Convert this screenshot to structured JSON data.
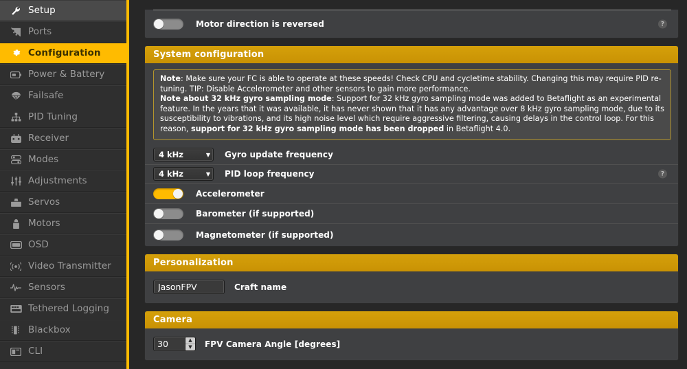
{
  "app": {
    "accent": "#ffbb00",
    "header_color": "#cd9706",
    "panel_bg": "#3f4042",
    "sidebar_bg": "#2f2f2f"
  },
  "sidebar": {
    "items": [
      {
        "label": "Setup",
        "icon": "wrench-icon",
        "state": "hover"
      },
      {
        "label": "Ports",
        "icon": "plug-icon",
        "state": "normal"
      },
      {
        "label": "Configuration",
        "icon": "gear-icon",
        "state": "selected"
      },
      {
        "label": "Power & Battery",
        "icon": "battery-icon",
        "state": "normal"
      },
      {
        "label": "Failsafe",
        "icon": "parachute-icon",
        "state": "normal"
      },
      {
        "label": "PID Tuning",
        "icon": "sitemap-icon",
        "state": "normal"
      },
      {
        "label": "Receiver",
        "icon": "transmitter-icon",
        "state": "normal"
      },
      {
        "label": "Modes",
        "icon": "sliders-stack-icon",
        "state": "normal"
      },
      {
        "label": "Adjustments",
        "icon": "faders-icon",
        "state": "normal"
      },
      {
        "label": "Servos",
        "icon": "servo-icon",
        "state": "normal"
      },
      {
        "label": "Motors",
        "icon": "motor-icon",
        "state": "normal"
      },
      {
        "label": "OSD",
        "icon": "osd-icon",
        "state": "normal"
      },
      {
        "label": "Video Transmitter",
        "icon": "antenna-icon",
        "state": "normal"
      },
      {
        "label": "Sensors",
        "icon": "waveform-icon",
        "state": "normal"
      },
      {
        "label": "Tethered Logging",
        "icon": "logging-icon",
        "state": "normal"
      },
      {
        "label": "Blackbox",
        "icon": "blackbox-icon",
        "state": "normal"
      },
      {
        "label": "CLI",
        "icon": "terminal-icon",
        "state": "normal"
      }
    ]
  },
  "main": {
    "motor_panel": {
      "motor_direction": {
        "label": "Motor direction is reversed",
        "toggle_on": false,
        "help": "?"
      }
    },
    "system_configuration": {
      "title": "System configuration",
      "note": {
        "note1_bold": "Note",
        "note1_text": ": Make sure your FC is able to operate at these speeds! Check CPU and cycletime stability. Changing this may require PID re-tuning. TIP: Disable Accelerometer and other sensors to gain more performance.",
        "note2_bold": "Note about 32 kHz gyro sampling mode",
        "note2_text_a": ": Support for 32 kHz gyro sampling mode was added to Betaflight as an experimental feature. In the years that it was available, it has never shown that it has any advantage over 8 kHz gyro sampling mode, due to its susceptibility to vibrations, and its high noise level which require aggressive filtering, causing delays in the control loop. For this reason, ",
        "note2_bold_tail": "support for 32 kHz gyro sampling mode has been dropped",
        "note2_text_b": " in Betaflight 4.0."
      },
      "gyro_update": {
        "value": "4 kHz",
        "label": "Gyro update frequency"
      },
      "pid_loop": {
        "value": "4 kHz",
        "label": "PID loop frequency",
        "help": "?"
      },
      "accelerometer": {
        "label": "Accelerometer",
        "toggle_on": true
      },
      "barometer": {
        "label": "Barometer (if supported)",
        "toggle_on": false
      },
      "magnetometer": {
        "label": "Magnetometer (if supported)",
        "toggle_on": false
      }
    },
    "personalization": {
      "title": "Personalization",
      "craft_name": {
        "value": "JasonFPV",
        "label": "Craft name"
      }
    },
    "camera": {
      "title": "Camera",
      "fpv_angle": {
        "value": "30",
        "label": "FPV Camera Angle [degrees]"
      }
    }
  }
}
